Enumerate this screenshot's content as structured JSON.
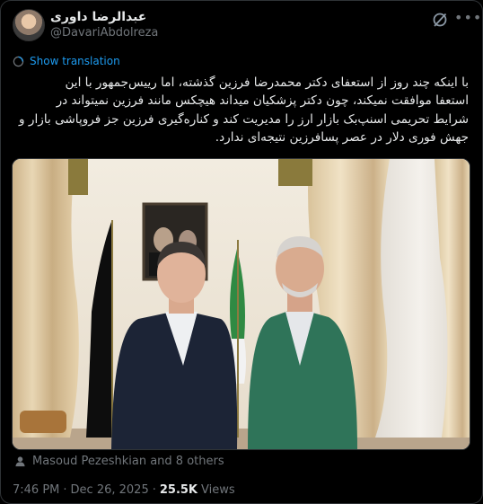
{
  "author": {
    "name": "عبدالرضا داوری",
    "handle": "@DavariAbdolreza"
  },
  "translation": {
    "label": "Show translation"
  },
  "tweet": {
    "lines": [
      "با اینکه چند روز از استعفای دکتر محمدرضا فرزین گذشته، اما رییس‌جمهور با این",
      "استعفا موافقت نمیکند، چون دکتر پزشکیان میداند هیچکس مانند فرزین نمیتواند در",
      "شرایط تحریمی اسنپ‌بک بازار ارز را مدیریت کند و کناره‌گیری فرزین جز فروپاشی بازار و",
      "جهش فوری دلار در عصر پسافرزین نتیجه‌ای ندارد."
    ]
  },
  "likes": {
    "text": "Masoud Pezeshkian and 8 others"
  },
  "meta": {
    "time": "7:46 PM",
    "separator": "·",
    "date": "Dec 26, 2025",
    "views_count": "25.5K",
    "views_label": "Views"
  },
  "colors": {
    "background": "#000000",
    "text": "#e7e9ea",
    "secondary": "#71767b",
    "link": "#1d9bf0",
    "border": "#2f3336"
  },
  "icons": [
    "grok-icon",
    "more-icon",
    "translate-icon",
    "person-icon"
  ]
}
